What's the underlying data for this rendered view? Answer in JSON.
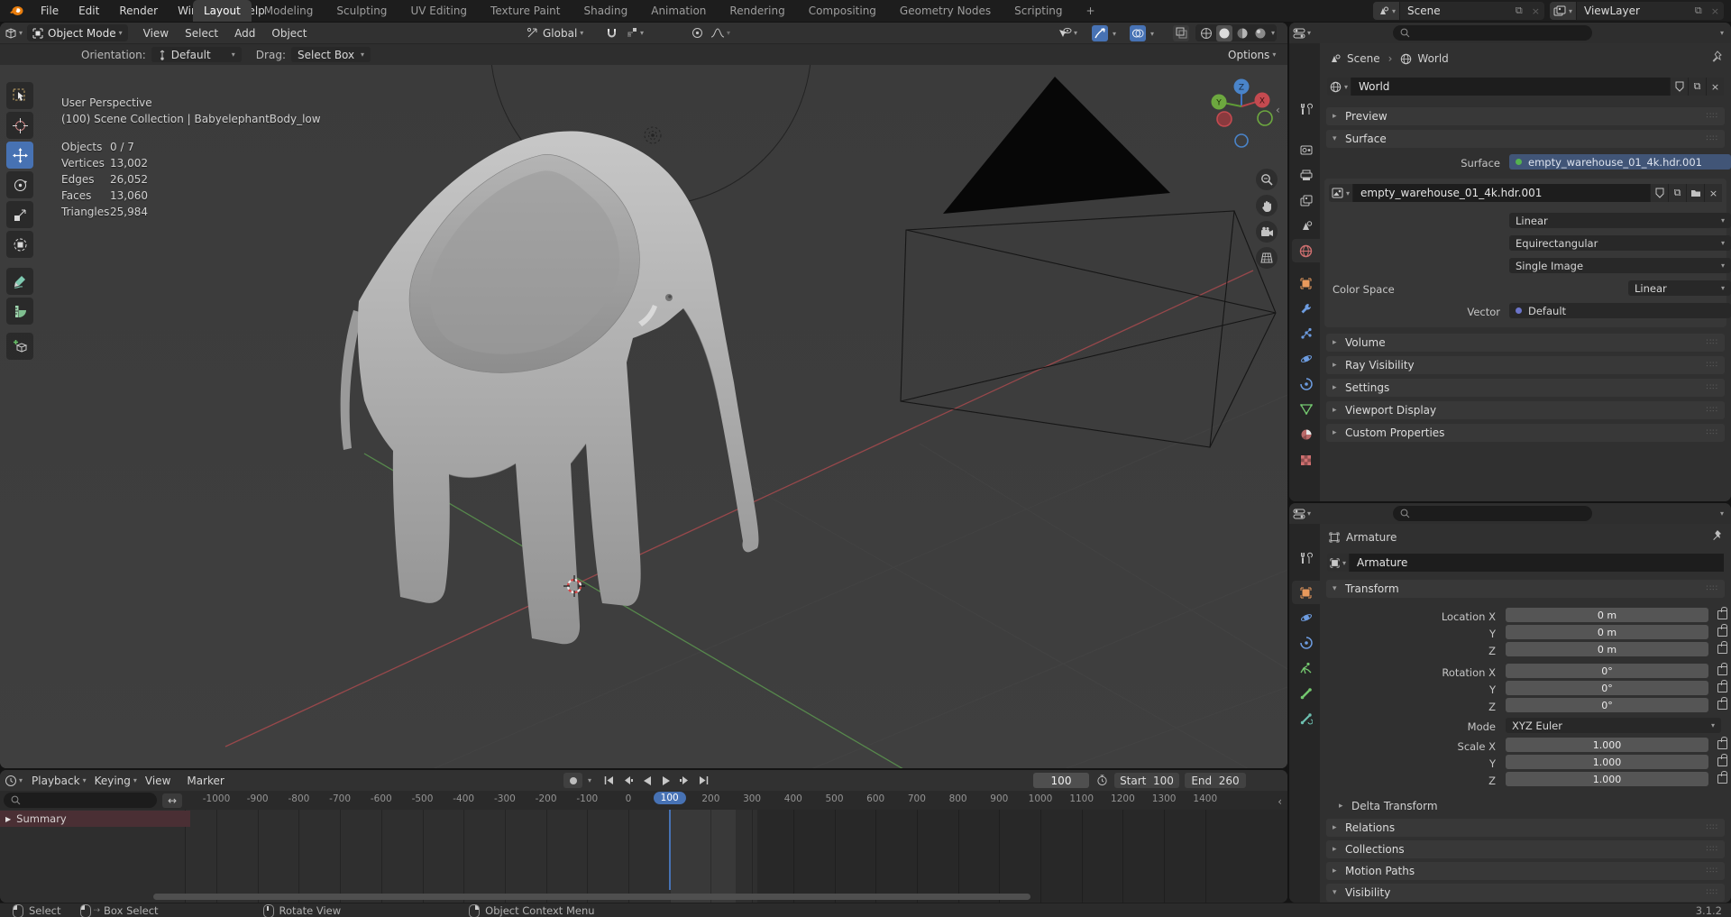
{
  "colors": {
    "accent_blue": "#4772b4",
    "logo_orange": "#e87d0d",
    "viewport_bg": "#3d3d3d",
    "summary_red": "#4a2f34",
    "surface_field_blue": "#415577"
  },
  "topbar": {
    "menus": [
      "File",
      "Edit",
      "Render",
      "Window",
      "Help"
    ],
    "tabs": [
      "Layout",
      "Modeling",
      "Sculpting",
      "UV Editing",
      "Texture Paint",
      "Shading",
      "Animation",
      "Rendering",
      "Compositing",
      "Geometry Nodes",
      "Scripting"
    ],
    "active_tab": "Layout",
    "add_tab_label": "+",
    "scene_name": "Scene",
    "viewlayer_name": "ViewLayer"
  },
  "viewport": {
    "header": {
      "mode": "Object Mode",
      "menu_view": "View",
      "menu_select": "Select",
      "menu_add": "Add",
      "menu_object": "Object",
      "orientation": "Global"
    },
    "tool_settings": {
      "orientation_label": "Orientation:",
      "orientation_value": "Default",
      "drag_label": "Drag:",
      "drag_value": "Select Box",
      "options_label": "Options"
    },
    "overlay": {
      "view_name": "User Perspective",
      "context": "(100) Scene Collection | BabyelephantBody_low",
      "stats": [
        {
          "label": "Objects",
          "value": "0 / 7"
        },
        {
          "label": "Vertices",
          "value": "13,002"
        },
        {
          "label": "Edges",
          "value": "26,052"
        },
        {
          "label": "Faces",
          "value": "13,060"
        },
        {
          "label": "Triangles",
          "value": "25,984"
        }
      ]
    },
    "gizmo": {
      "x": "X",
      "y": "Y",
      "z": "Z"
    }
  },
  "properties_world": {
    "breadcrumb": {
      "scene": "Scene",
      "separator": "›",
      "world": "World"
    },
    "datablock_name": "World",
    "panels": {
      "preview": "Preview",
      "surface": "Surface",
      "volume": "Volume",
      "ray_visibility": "Ray Visibility",
      "settings": "Settings",
      "viewport_display": "Viewport Display",
      "custom_properties": "Custom Properties"
    },
    "surface": {
      "surface_label": "Surface",
      "surface_value": "empty_warehouse_01_4k.hdr.001",
      "image_name": "empty_warehouse_01_4k.hdr.001",
      "interpolation": "Linear",
      "projection": "Equirectangular",
      "source": "Single Image",
      "color_space_label": "Color Space",
      "color_space_value": "Linear",
      "vector_label": "Vector",
      "vector_value": "Default"
    }
  },
  "properties_object": {
    "breadcrumb_object": "Armature",
    "datablock_name": "Armature",
    "panels": {
      "transform": "Transform",
      "delta_transform": "Delta Transform",
      "relations": "Relations",
      "collections": "Collections",
      "motion_paths": "Motion Paths",
      "visibility": "Visibility"
    },
    "transform": {
      "rows": [
        {
          "label": "Location X",
          "value": "0 m"
        },
        {
          "label": "Y",
          "value": "0 m"
        },
        {
          "label": "Z",
          "value": "0 m"
        },
        {
          "label": "Rotation X",
          "value": "0°"
        },
        {
          "label": "Y",
          "value": "0°"
        },
        {
          "label": "Z",
          "value": "0°"
        }
      ],
      "mode_label": "Mode",
      "mode_value": "XYZ Euler",
      "scale_rows": [
        {
          "label": "Scale X",
          "value": "1.000"
        },
        {
          "label": "Y",
          "value": "1.000"
        },
        {
          "label": "Z",
          "value": "1.000"
        }
      ]
    }
  },
  "timeline": {
    "menus": [
      "Playback",
      "Keying",
      "View",
      "Marker"
    ],
    "current_frame": "100",
    "start_label": "Start",
    "start_value": "100",
    "end_label": "End",
    "end_value": "260",
    "playhead_frame": "100",
    "ruler_ticks": [
      "-1000",
      "-900",
      "-800",
      "-700",
      "-600",
      "-500",
      "-400",
      "-300",
      "-200",
      "-100",
      "0",
      "100",
      "200",
      "300",
      "400",
      "500",
      "600",
      "700",
      "800",
      "900",
      "1000",
      "1100",
      "1200",
      "1300",
      "1400"
    ],
    "channel_summary": "Summary"
  },
  "statusbar": {
    "items": [
      {
        "icon": "mouse-left-icon",
        "label": "Select"
      },
      {
        "icon": "mouse-drag-icon",
        "label": "Box Select"
      },
      {
        "icon": "mouse-middle-icon",
        "label": "Rotate View"
      },
      {
        "icon": "mouse-right-icon",
        "label": "Object Context Menu"
      }
    ],
    "version": "3.1.2"
  }
}
